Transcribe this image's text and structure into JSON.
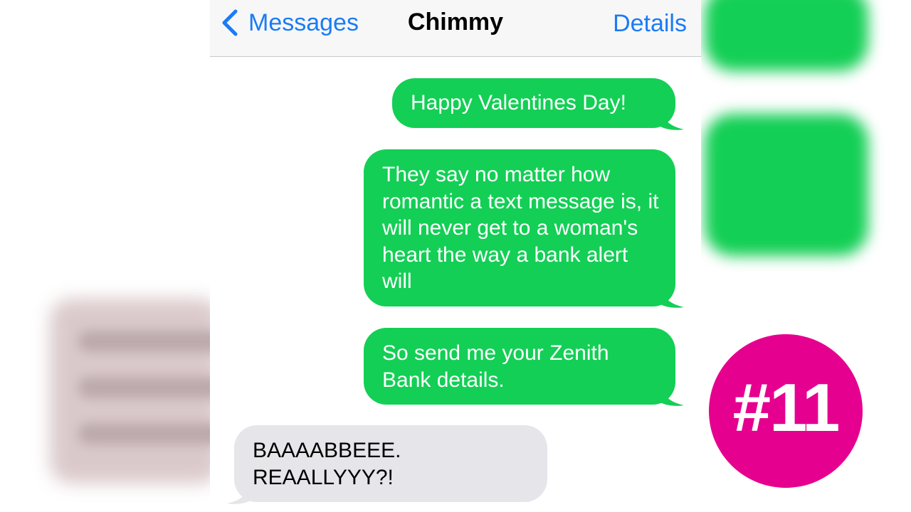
{
  "nav": {
    "back_label": "Messages",
    "title": "Chimmy",
    "details_label": "Details"
  },
  "messages": [
    {
      "direction": "outgoing",
      "text": "Happy Valentines Day!"
    },
    {
      "direction": "outgoing",
      "text": "They say no matter how romantic a text message is, it will never get to a woman's heart the way a bank alert will"
    },
    {
      "direction": "outgoing",
      "text": "So send me your Zenith Bank details."
    },
    {
      "direction": "incoming",
      "text": "BAAAABBEEE. REAALLYYY?!"
    }
  ],
  "badge": {
    "label": "#11",
    "color": "#e6008f"
  },
  "colors": {
    "outgoing_bubble": "#13cf55",
    "incoming_bubble": "#e5e5ea",
    "ios_blue": "#1a7cf5"
  },
  "icons": {
    "back": "chevron-left-icon"
  }
}
